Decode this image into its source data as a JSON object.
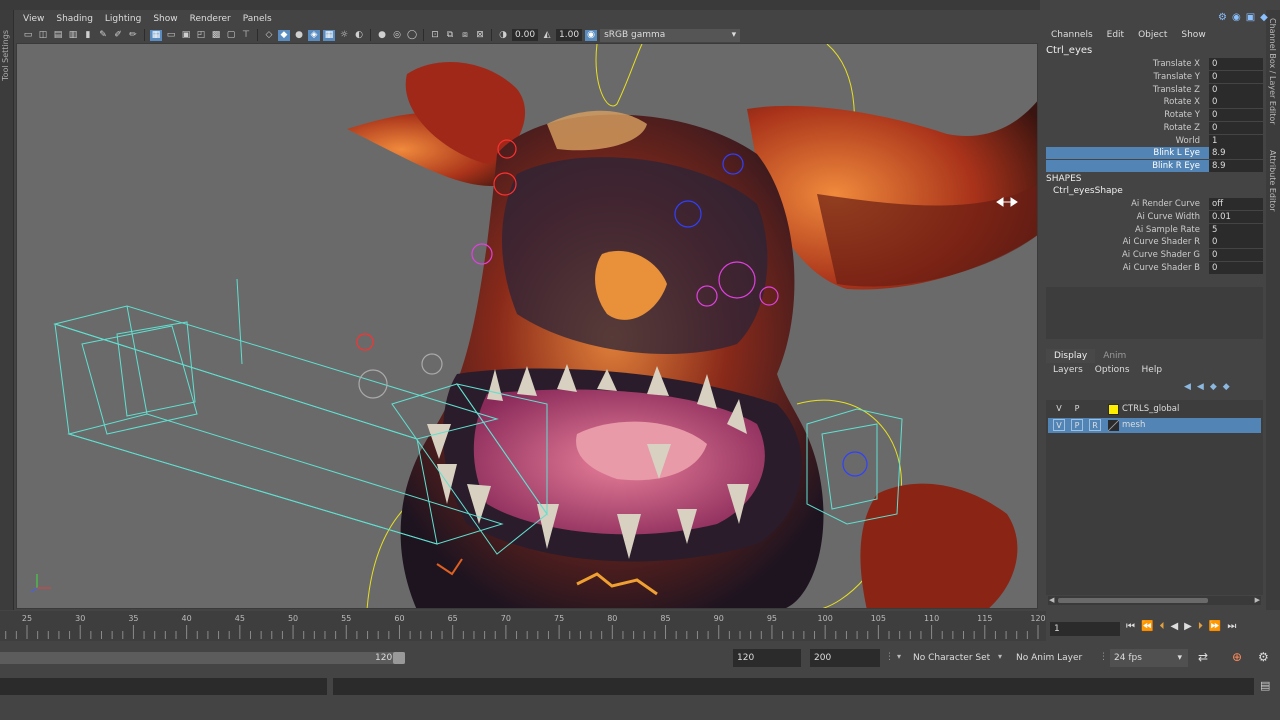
{
  "left_strip": {
    "label": "Tool Settings"
  },
  "viewport_menu": [
    "View",
    "Shading",
    "Lighting",
    "Show",
    "Renderer",
    "Panels"
  ],
  "viewport_toolbar": {
    "exposure": "0.00",
    "gamma": "1.00",
    "color_space": "sRGB gamma"
  },
  "channel_box": {
    "menu": [
      "Channels",
      "Edit",
      "Object",
      "Show"
    ],
    "object_name": "Ctrl_eyes",
    "attributes": [
      {
        "label": "Translate X",
        "value": "0",
        "selected": false
      },
      {
        "label": "Translate Y",
        "value": "0",
        "selected": false
      },
      {
        "label": "Translate Z",
        "value": "0",
        "selected": false
      },
      {
        "label": "Rotate X",
        "value": "0",
        "selected": false
      },
      {
        "label": "Rotate Y",
        "value": "0",
        "selected": false
      },
      {
        "label": "Rotate Z",
        "value": "0",
        "selected": false
      },
      {
        "label": "World",
        "value": "1",
        "selected": false
      },
      {
        "label": "Blink L Eye",
        "value": "8.9",
        "selected": true
      },
      {
        "label": "Blink R Eye",
        "value": "8.9",
        "selected": true
      }
    ],
    "shapes_header": "SHAPES",
    "shape_name": "Ctrl_eyesShape",
    "shape_attributes": [
      {
        "label": "Ai Render Curve",
        "value": "off"
      },
      {
        "label": "Ai Curve Width",
        "value": "0.01"
      },
      {
        "label": "Ai Sample Rate",
        "value": "5"
      },
      {
        "label": "Ai Curve Shader R",
        "value": "0"
      },
      {
        "label": "Ai Curve Shader G",
        "value": "0"
      },
      {
        "label": "Ai Curve Shader B",
        "value": "0"
      }
    ]
  },
  "right_tabs": [
    "Channel Box / Layer Editor",
    "Attribute Editor"
  ],
  "layer_editor": {
    "tabs": [
      "Display",
      "Anim"
    ],
    "menu": [
      "Layers",
      "Options",
      "Help"
    ],
    "layers": [
      {
        "v": "V",
        "p": "P",
        "r": "",
        "color": "#ffee00",
        "name": "CTRLS_global",
        "selected": false
      },
      {
        "v": "V",
        "p": "P",
        "r": "R",
        "color": "#2b2b2b",
        "name": "mesh",
        "selected": true
      }
    ]
  },
  "timeline": {
    "ticks": [
      "25",
      "30",
      "35",
      "40",
      "45",
      "50",
      "55",
      "60",
      "65",
      "70",
      "75",
      "80",
      "85",
      "90",
      "95",
      "100",
      "105",
      "110",
      "115",
      "120"
    ],
    "current_frame": "1"
  },
  "range_bar": {
    "slider_end": "120",
    "anim_end": "120",
    "playback_end": "200",
    "character_set": "No Character Set",
    "anim_layer": "No Anim Layer",
    "fps": "24 fps"
  }
}
